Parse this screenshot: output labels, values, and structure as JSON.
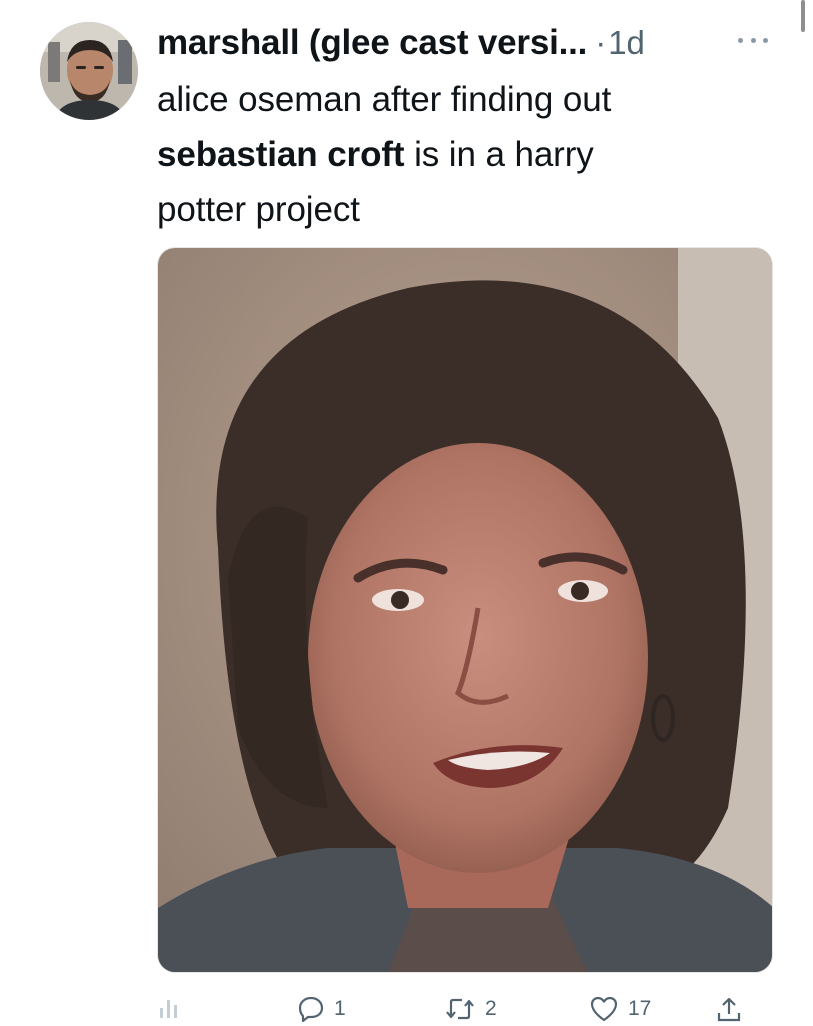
{
  "tweet": {
    "author": {
      "display_name": "marshall (glee cast versi...",
      "avatar_icon": "user-avatar"
    },
    "separator": "·",
    "timestamp": "1d",
    "more_icon": "more-horizontal-icon",
    "text": {
      "line1": "alice oseman after finding out",
      "mention": "sebastian croft",
      "line2_rest": " is in a harry",
      "line3": "potter project"
    },
    "media": {
      "type": "photo"
    },
    "actions": {
      "analytics": {
        "icon": "analytics-icon"
      },
      "reply": {
        "icon": "reply-icon",
        "count": "1"
      },
      "retweet": {
        "icon": "retweet-icon",
        "count": "2"
      },
      "like": {
        "icon": "like-icon",
        "count": "17"
      },
      "share": {
        "icon": "share-icon"
      }
    }
  },
  "colors": {
    "text": "#0f1419",
    "secondary": "#536471"
  }
}
